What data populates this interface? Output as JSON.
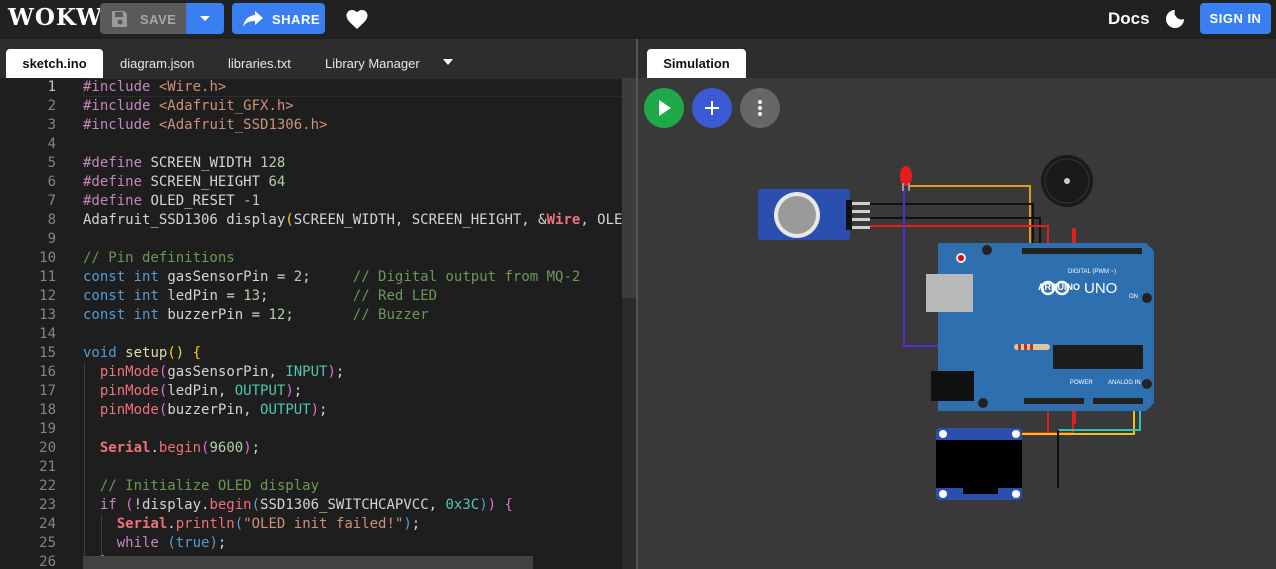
{
  "header": {
    "logo": "WOKWI",
    "save_label": "SAVE",
    "share_label": "SHARE",
    "docs_label": "Docs",
    "signin_label": "SIGN IN"
  },
  "editor_tabs": [
    {
      "label": "sketch.ino"
    },
    {
      "label": "diagram.json"
    },
    {
      "label": "libraries.txt"
    },
    {
      "label": "Library Manager"
    }
  ],
  "sim_tab": {
    "label": "Simulation"
  },
  "code": {
    "line_numbers": [
      "1",
      "2",
      "3",
      "4",
      "5",
      "6",
      "7",
      "8",
      "9",
      "10",
      "11",
      "12",
      "13",
      "14",
      "15",
      "16",
      "17",
      "18",
      "19",
      "20",
      "21",
      "22",
      "23",
      "24",
      "25",
      "26"
    ]
  },
  "board": {
    "uno_label": "UNO",
    "arduino_label": "ARDUINO",
    "digital_label": "DIGITAL (PWM ~)",
    "analog_label": "ANALOG IN",
    "power_label": "POWER",
    "on_label": "ON"
  },
  "colors": {
    "accent": "#3a7ff1",
    "play": "#1faa4a",
    "add": "#3b5bd6",
    "more": "#666666"
  }
}
